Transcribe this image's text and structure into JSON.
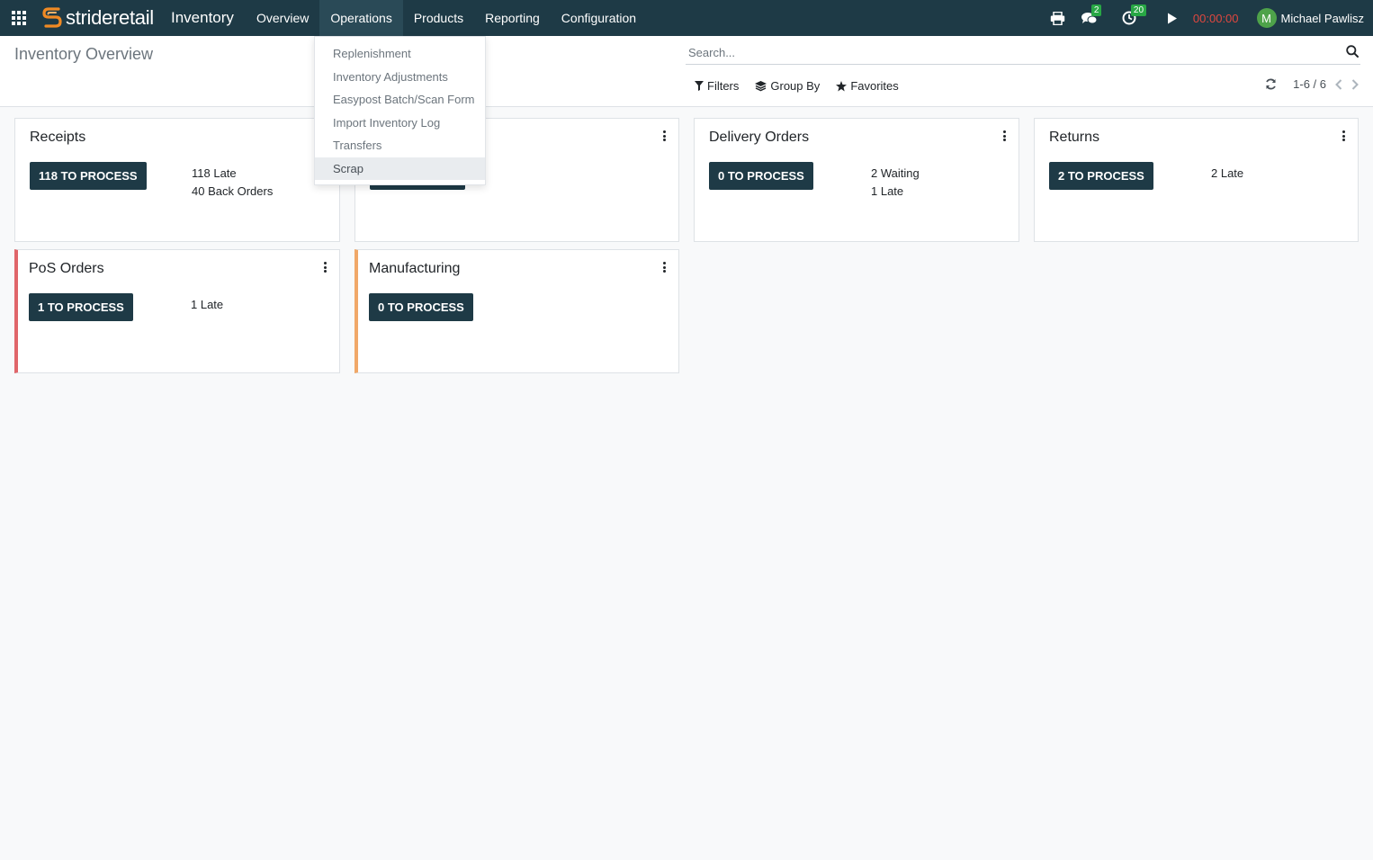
{
  "navbar": {
    "brand": "strideretail",
    "app_name": "Inventory",
    "menu": [
      "Overview",
      "Operations",
      "Products",
      "Reporting",
      "Configuration"
    ],
    "messages_count": "2",
    "activities_count": "20",
    "timer": "00:00:00",
    "user_initial": "M",
    "user_name": "Michael Pawlisz"
  },
  "control_panel": {
    "title": "Inventory Overview",
    "search_placeholder": "Search...",
    "filters_label": "Filters",
    "group_by_label": "Group By",
    "favorites_label": "Favorites",
    "pager": "1-6 / 6"
  },
  "operations_menu": {
    "items": [
      "Replenishment",
      "Inventory Adjustments",
      "Easypost Batch/Scan Form",
      "Import Inventory Log",
      "Transfers",
      "Scrap"
    ]
  },
  "cards": [
    {
      "title": "Receipts",
      "button": "118 TO PROCESS",
      "stats": [
        "118 Late",
        "40 Back Orders"
      ]
    },
    {
      "title": "",
      "button": "",
      "stats": []
    },
    {
      "title": "Delivery Orders",
      "button": "0 TO PROCESS",
      "stats": [
        "2 Waiting",
        "1 Late"
      ]
    },
    {
      "title": "Returns",
      "button": "2 TO PROCESS",
      "stats": [
        "2 Late"
      ]
    },
    {
      "title": "PoS Orders",
      "button": "1 TO PROCESS",
      "stats": [
        "1 Late"
      ]
    },
    {
      "title": "Manufacturing",
      "button": "0 TO PROCESS",
      "stats": []
    }
  ],
  "colors": {
    "navbar": "#1e3a46",
    "button": "#1e3a46",
    "badge": "#28a745",
    "timer": "#e0473f",
    "pos_border": "#e0666a",
    "manufacturing_border": "#f0a868"
  }
}
